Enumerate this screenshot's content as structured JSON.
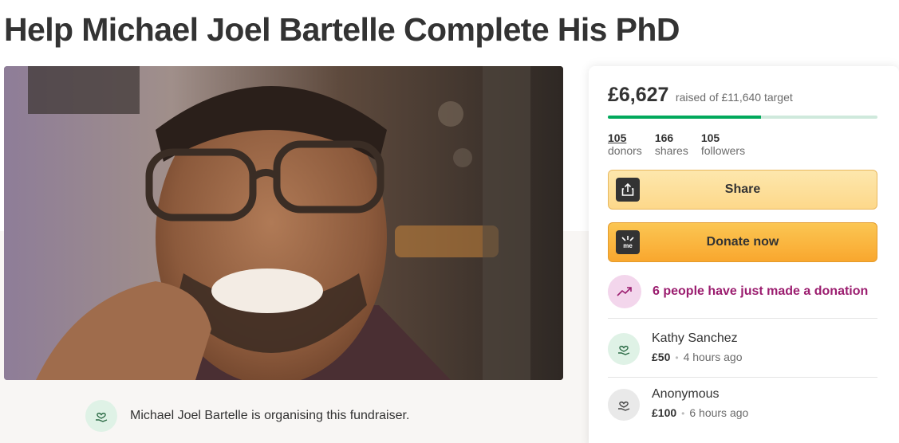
{
  "page": {
    "title": "Help Michael Joel Bartelle Complete His PhD"
  },
  "hero": {
    "image": "photo-of-smiling-man-with-glasses"
  },
  "organiser": {
    "text": "Michael Joel Bartelle is organising this fundraiser.",
    "icon": "heart-hand-icon"
  },
  "campaign": {
    "raised": "£6,627",
    "target_text": "raised of £11,640 target",
    "progress_fraction": 0.569,
    "stats": [
      {
        "value": "105",
        "label": "donors"
      },
      {
        "value": "166",
        "label": "shares"
      },
      {
        "value": "105",
        "label": "followers"
      }
    ]
  },
  "buttons": {
    "share_label": "Share",
    "donate_label": "Donate now"
  },
  "recent_activity": {
    "text": "6 people have just made a donation",
    "icon": "trending-up-icon"
  },
  "donations": [
    {
      "name": "Kathy Sanchez",
      "amount": "£50",
      "time": "4 hours ago"
    },
    {
      "name": "Anonymous",
      "amount": "£100",
      "time": "6 hours ago"
    }
  ],
  "colors": {
    "progress": "#02a95c",
    "share_button": "#fdd88a",
    "donate_button": "#f9a72e",
    "recent_text": "#9b1d6f"
  }
}
